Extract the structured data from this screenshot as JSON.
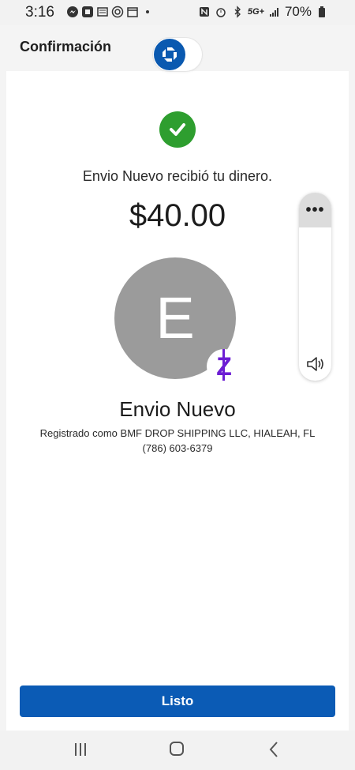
{
  "statusbar": {
    "time": "3:16",
    "left_icons": [
      "messenger-icon",
      "chase-icon",
      "news-icon",
      "target-icon",
      "calendar-icon",
      "dot-icon"
    ],
    "right_icons": [
      "nfc-icon",
      "alarm-icon",
      "bluetooth-icon",
      "signal-icon",
      "battery-icon"
    ],
    "network": "5G+",
    "battery": "70%"
  },
  "header": {
    "title": "Confirmación",
    "logo_icon": "chase-logo-icon"
  },
  "main": {
    "status_icon": "check-circle-icon",
    "confirm_text": "Envio Nuevo recibió tu dinero.",
    "amount": "$40.00",
    "avatar_letter": "E",
    "badge_icon": "zelle-icon",
    "badge_text": "Z",
    "recipient_name": "Envio Nuevo",
    "registered_text": "Registrado como BMF DROP SHIPPING LLC, HIALEAH, FL",
    "phone": "(786) 603-6379"
  },
  "volume_panel": {
    "more_label": "•••",
    "speaker_icon": "speaker-icon"
  },
  "actions": {
    "done_label": "Listo"
  },
  "navbar": {
    "icons": [
      "recents-icon",
      "home-icon",
      "back-icon"
    ]
  },
  "colors": {
    "brand_blue": "#0b5bb5",
    "success_green": "#2e9e2f",
    "zelle_purple": "#6d1ed4",
    "avatar_gray": "#9b9b9b"
  }
}
